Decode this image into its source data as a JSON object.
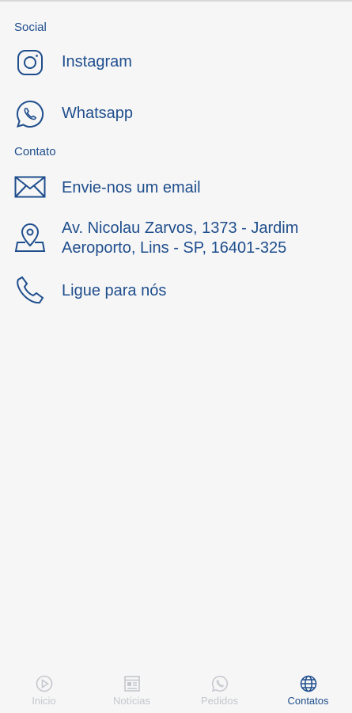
{
  "sections": {
    "social_title": "Social",
    "contato_title": "Contato"
  },
  "social": [
    {
      "label": "Instagram",
      "icon": "instagram-icon"
    },
    {
      "label": "Whatsapp",
      "icon": "whatsapp-icon"
    }
  ],
  "contato": [
    {
      "label": "Envie-nos um email",
      "icon": "mail-icon"
    },
    {
      "label": "Av. Nicolau Zarvos, 1373 - Jardim Aeroporto, Lins - SP, 16401-325",
      "icon": "map-pin-icon"
    },
    {
      "label": "Ligue para nós",
      "icon": "phone-icon"
    }
  ],
  "nav": [
    {
      "label": "Inicio",
      "icon": "play-circle-icon",
      "active": false
    },
    {
      "label": "Notícias",
      "icon": "newspaper-icon",
      "active": false
    },
    {
      "label": "Pedidos",
      "icon": "whatsapp-icon",
      "active": false
    },
    {
      "label": "Contatos",
      "icon": "globe-icon",
      "active": true
    }
  ],
  "colors": {
    "primary": "#1f4e8c",
    "inactive": "#c4c7cc",
    "background": "#f6f6f7"
  }
}
